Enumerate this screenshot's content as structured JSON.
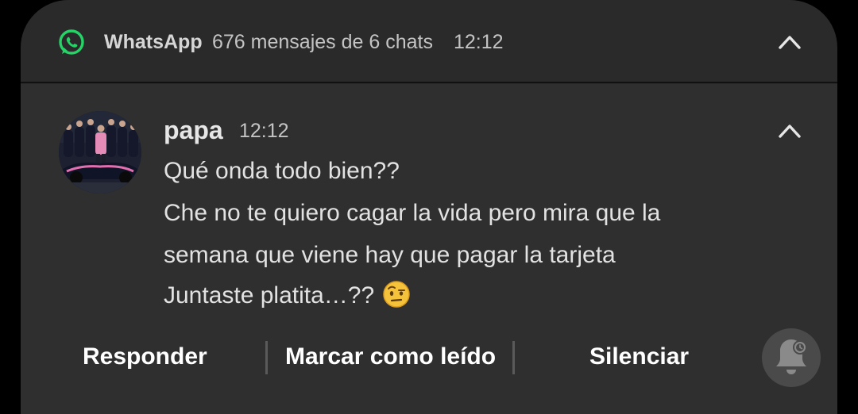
{
  "group": {
    "app_name": "WhatsApp",
    "summary": "676 mensajes de 6 chats",
    "time": "12:12",
    "icon": "whatsapp-icon",
    "collapse_icon": "chevron-up-icon"
  },
  "message": {
    "sender": "papa",
    "time": "12:12",
    "avatar": "contact-avatar",
    "collapse_icon": "chevron-up-icon",
    "lines": [
      "Qué onda todo bien??",
      "Che no te quiero cagar la vida pero mira que la",
      "semana que viene hay que pagar la tarjeta",
      "Juntaste platita…??"
    ],
    "emoji": "raised-eyebrow-emoji"
  },
  "actions": {
    "reply": "Responder",
    "mark_read": "Marcar como leído",
    "mute": "Silenciar",
    "bell_icon": "bell-snooze-icon"
  },
  "colors": {
    "whatsapp_green": "#25d366",
    "card_bg": "#2f2f2f",
    "header_bg": "#2a2a2a"
  }
}
